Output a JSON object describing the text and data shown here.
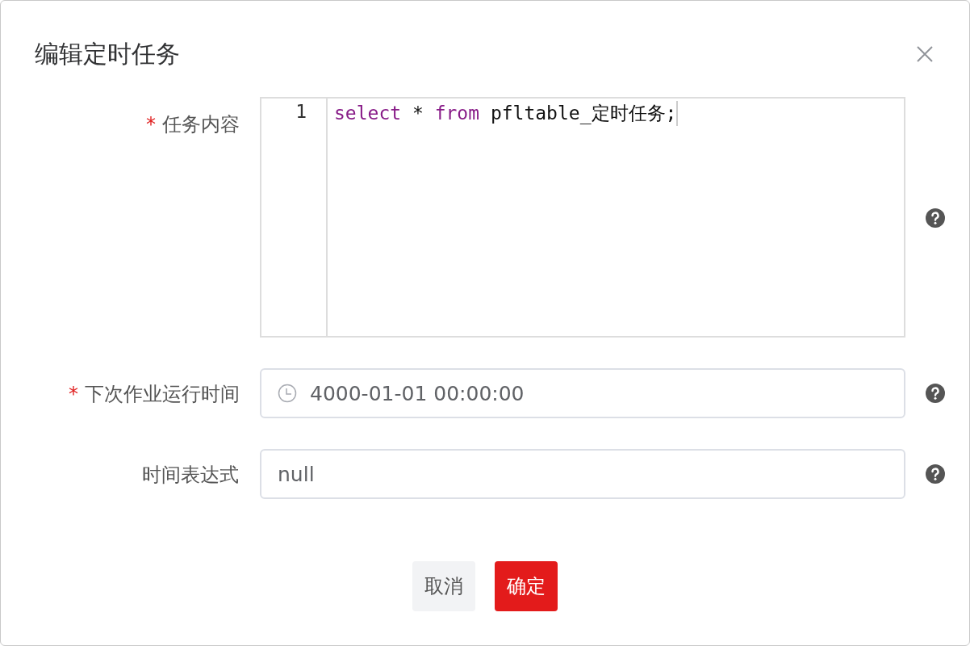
{
  "dialog": {
    "title": "编辑定时任务"
  },
  "fields": [
    {
      "kind": "code",
      "label": "任务内容",
      "required": true,
      "marker": "*",
      "lines": [
        {
          "number": "1",
          "tokens": [
            {
              "text": "select",
              "kind": "keyword"
            },
            {
              "text": " * ",
              "kind": "plain"
            },
            {
              "text": "from",
              "kind": "keyword"
            },
            {
              "text": " pfltable_定时任务;",
              "kind": "plain"
            }
          ]
        }
      ]
    },
    {
      "kind": "datetime",
      "label": "下次作业运行时间",
      "required": true,
      "marker": "*",
      "value": "4000-01-01 00:00:00"
    },
    {
      "kind": "text",
      "label": "时间表达式",
      "required": false,
      "value": "null"
    }
  ],
  "buttons": [
    {
      "label": "取消",
      "kind": "secondary"
    },
    {
      "label": "确定",
      "kind": "primary"
    }
  ]
}
